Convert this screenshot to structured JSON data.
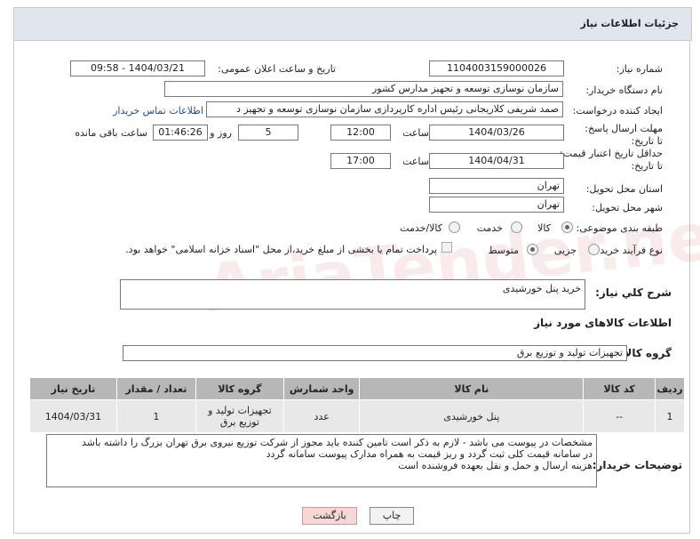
{
  "header": {
    "title": "جزئیات اطلاعات نیاز"
  },
  "form": {
    "need_number_label": "شماره نیاز:",
    "need_number": "1104003159000026",
    "announce_label": "تاریخ و ساعت اعلان عمومی:",
    "announce_value": "1404/03/21 - 09:58",
    "buyer_org_label": "نام دستگاه خریدار:",
    "buyer_org": "سازمان نوسازی  توسعه و تجهیز مدارس کشور",
    "creator_label": "ایجاد کننده درخواست:",
    "creator": "صمد شریفی کلاریجانی رئیس اداره کارپردازی سازمان نوسازی  توسعه و تجهیز د",
    "contact_link": "اطلاعات تماس خریدار",
    "reply_deadline_label": "مهلت ارسال پاسخ: تا تاریخ:",
    "reply_date": "1404/03/26",
    "time_label": "ساعت",
    "reply_time": "12:00",
    "days_value": "5",
    "days_label": "روز و",
    "remaining_value": "01:46:26",
    "remaining_label": "ساعت باقی مانده",
    "price_validity_label": "حداقل تاریخ اعتبار قیمت: تا تاریخ:",
    "price_date": "1404/04/31",
    "price_time": "17:00",
    "province_label": "استان محل تحویل:",
    "province": "تهران",
    "city_label": "شهر محل تحویل:",
    "city": "تهران",
    "category_label": "طبقه بندی موضوعی:",
    "category_options": {
      "goods": "کالا",
      "service": "خدمت",
      "goods_service": "کالا/خدمت"
    },
    "process_label": "نوع فرآیند خرید :",
    "process_options": {
      "partial": "جزیی",
      "medium": "متوسط"
    },
    "treasury_note": "پرداخت تمام یا بخشی از مبلغ خرید،از محل \"اسناد خزانه اسلامی\" خواهد بود."
  },
  "description": {
    "label": "شرح كلي نياز:",
    "value": "خرید پنل خورشیدی"
  },
  "goods_info": {
    "title": "اطلاعات کالاهای مورد نیاز",
    "group_label": "گروه کالا:",
    "group_value": "تجهیزات تولید و توزیع برق"
  },
  "table": {
    "headers": [
      "ردیف",
      "کد کالا",
      "نام کالا",
      "واحد شمارش",
      "گروه کالا",
      "تعداد / مقدار",
      "تاریخ نیاز"
    ],
    "rows": [
      {
        "row": "1",
        "code": "--",
        "name": "پنل خورشیدی",
        "unit": "عدد",
        "group": "تجهیزات تولید و توزیع برق",
        "qty": "1",
        "date": "1404/03/31"
      }
    ]
  },
  "buyer_notes": {
    "label": "توضیحات خریدار:",
    "lines": [
      "مشخصات در پیوست می باشد - لازم به ذکر است تامین کننده باید مجوز از شرکت توزیع نیروی برق تهران بزرگ را داشته باشد",
      "در سامانه قیمت کلی ثبت گردد و ریز قیمت به همراه مدارک پیوست سامانه گردد",
      "هزینه ارسال و حمل و نقل بعهده فروشنده است"
    ]
  },
  "buttons": {
    "print": "چاپ",
    "back": "بازگشت"
  },
  "watermark": "AriaTender.neT"
}
